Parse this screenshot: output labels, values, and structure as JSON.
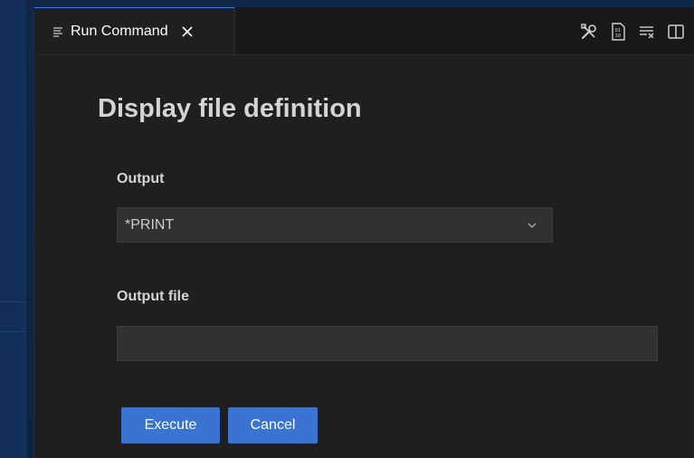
{
  "editor": {
    "tab": {
      "label": "Run Command",
      "icon": "lines-icon",
      "close_icon": "close-icon"
    },
    "toolbar": {
      "icons": [
        "tools-icon",
        "binary-file-icon",
        "clear-list-icon",
        "split-editor-icon"
      ]
    }
  },
  "form": {
    "title": "Display file definition",
    "output": {
      "label": "Output",
      "selected": "*PRINT"
    },
    "output_file": {
      "label": "Output file",
      "value": "",
      "placeholder": ""
    },
    "buttons": {
      "execute_label": "Execute",
      "cancel_label": "Cancel"
    }
  },
  "colors": {
    "accent": "#3a74d2",
    "editor_bg": "#1f1f1f",
    "tabbar_bg": "#181818",
    "input_bg": "#313131",
    "text": "#d4d4d4",
    "desktop_bg": "#10294a"
  }
}
